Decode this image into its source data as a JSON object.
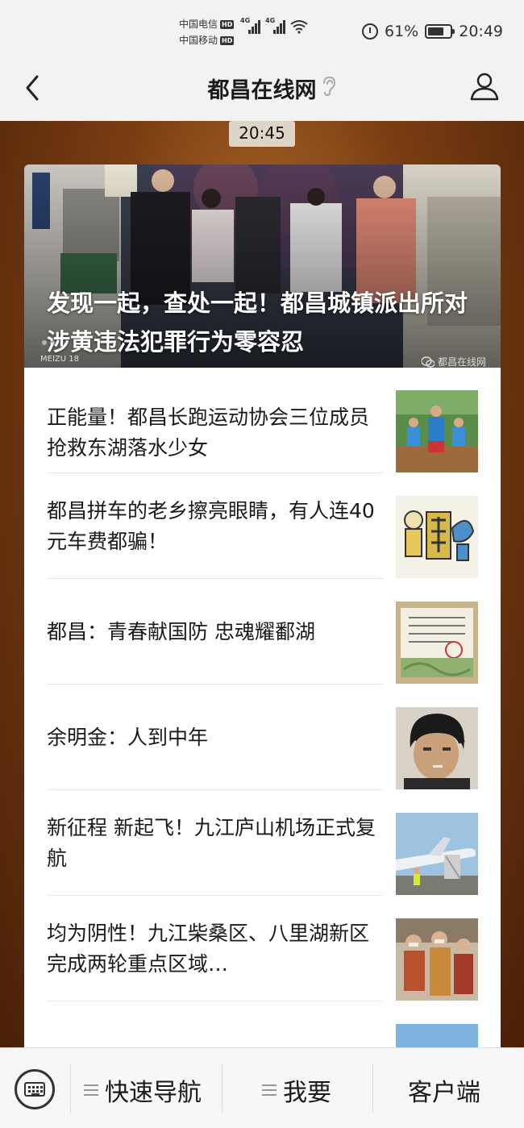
{
  "status_bar": {
    "carrier1": "中国电信",
    "carrier2": "中国移动",
    "hd": "HD",
    "network1": "4G",
    "network2": "4G",
    "battery_percent": "61%",
    "battery_level": 0.61,
    "time": "20:49"
  },
  "nav": {
    "title": "都昌在线网"
  },
  "chat": {
    "timestamp": "20:45"
  },
  "hero": {
    "title": "发现一起，查处一起！都昌城镇派出所对涉黄违法犯罪行为零容忍",
    "photo_mark": "MEIZU 18",
    "source_mark": "都昌在线网"
  },
  "news": [
    {
      "title": "正能量！都昌长跑运动协会三位成员抢救东湖落水少女",
      "thumb": "runners"
    },
    {
      "title": "都昌拼车的老乡擦亮眼睛，有人连40元车费都骗！",
      "thumb": "scam-cartoon"
    },
    {
      "title": "都昌：青春献国防 忠魂耀鄱湖",
      "thumb": "certificate"
    },
    {
      "title": "余明金：人到中年",
      "thumb": "portrait"
    },
    {
      "title": "新征程  新起飞！九江庐山机场正式复航",
      "thumb": "airplane"
    },
    {
      "title": "均为阴性！九江柴桑区、八里湖新区完成两轮重点区域…",
      "thumb": "crowd"
    }
  ],
  "bottom_bar": {
    "menu1": "快速导航",
    "menu2": "我要",
    "menu3": "客户端"
  }
}
